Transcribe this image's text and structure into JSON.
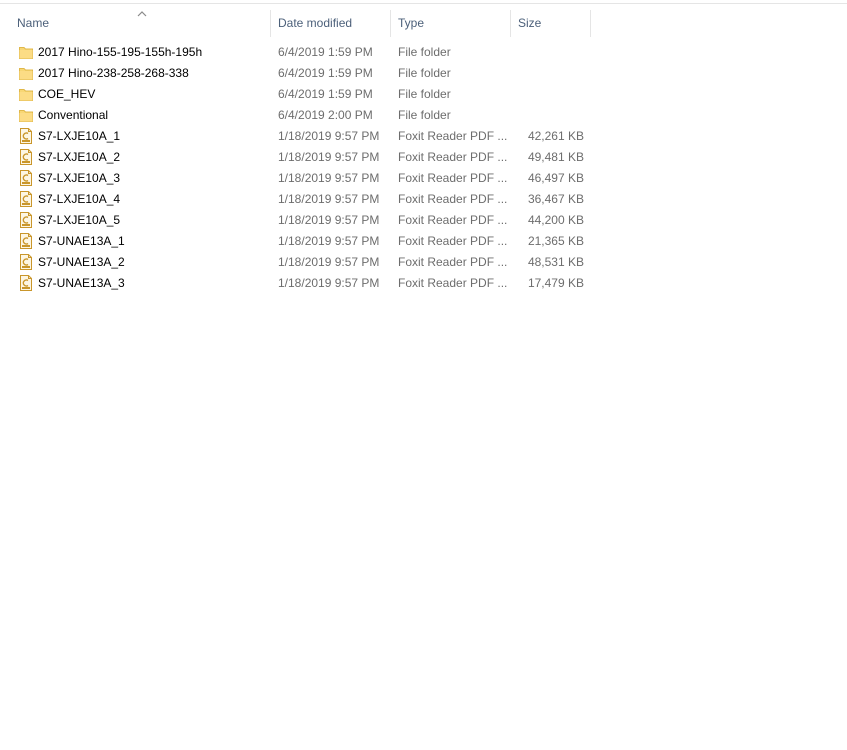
{
  "columns": {
    "name": "Name",
    "date": "Date modified",
    "type": "Type",
    "size": "Size"
  },
  "files": [
    {
      "icon": "folder-icon",
      "name": "2017 Hino-155-195-155h-195h",
      "date": "6/4/2019 1:59 PM",
      "type": "File folder",
      "size": ""
    },
    {
      "icon": "folder-icon",
      "name": "2017 Hino-238-258-268-338",
      "date": "6/4/2019 1:59 PM",
      "type": "File folder",
      "size": ""
    },
    {
      "icon": "folder-icon",
      "name": "COE_HEV",
      "date": "6/4/2019 1:59 PM",
      "type": "File folder",
      "size": ""
    },
    {
      "icon": "folder-icon",
      "name": "Conventional",
      "date": "6/4/2019 2:00 PM",
      "type": "File folder",
      "size": ""
    },
    {
      "icon": "pdf-file-icon",
      "name": "S7-LXJE10A_1",
      "date": "1/18/2019 9:57 PM",
      "type": "Foxit Reader PDF ...",
      "size": "42,261 KB"
    },
    {
      "icon": "pdf-file-icon",
      "name": "S7-LXJE10A_2",
      "date": "1/18/2019 9:57 PM",
      "type": "Foxit Reader PDF ...",
      "size": "49,481 KB"
    },
    {
      "icon": "pdf-file-icon",
      "name": "S7-LXJE10A_3",
      "date": "1/18/2019 9:57 PM",
      "type": "Foxit Reader PDF ...",
      "size": "46,497 KB"
    },
    {
      "icon": "pdf-file-icon",
      "name": "S7-LXJE10A_4",
      "date": "1/18/2019 9:57 PM",
      "type": "Foxit Reader PDF ...",
      "size": "36,467 KB"
    },
    {
      "icon": "pdf-file-icon",
      "name": "S7-LXJE10A_5",
      "date": "1/18/2019 9:57 PM",
      "type": "Foxit Reader PDF ...",
      "size": "44,200 KB"
    },
    {
      "icon": "pdf-file-icon",
      "name": "S7-UNAE13A_1",
      "date": "1/18/2019 9:57 PM",
      "type": "Foxit Reader PDF ...",
      "size": "21,365 KB"
    },
    {
      "icon": "pdf-file-icon",
      "name": "S7-UNAE13A_2",
      "date": "1/18/2019 9:57 PM",
      "type": "Foxit Reader PDF ...",
      "size": "48,531 KB"
    },
    {
      "icon": "pdf-file-icon",
      "name": "S7-UNAE13A_3",
      "date": "1/18/2019 9:57 PM",
      "type": "Foxit Reader PDF ...",
      "size": "17,479 KB"
    }
  ]
}
